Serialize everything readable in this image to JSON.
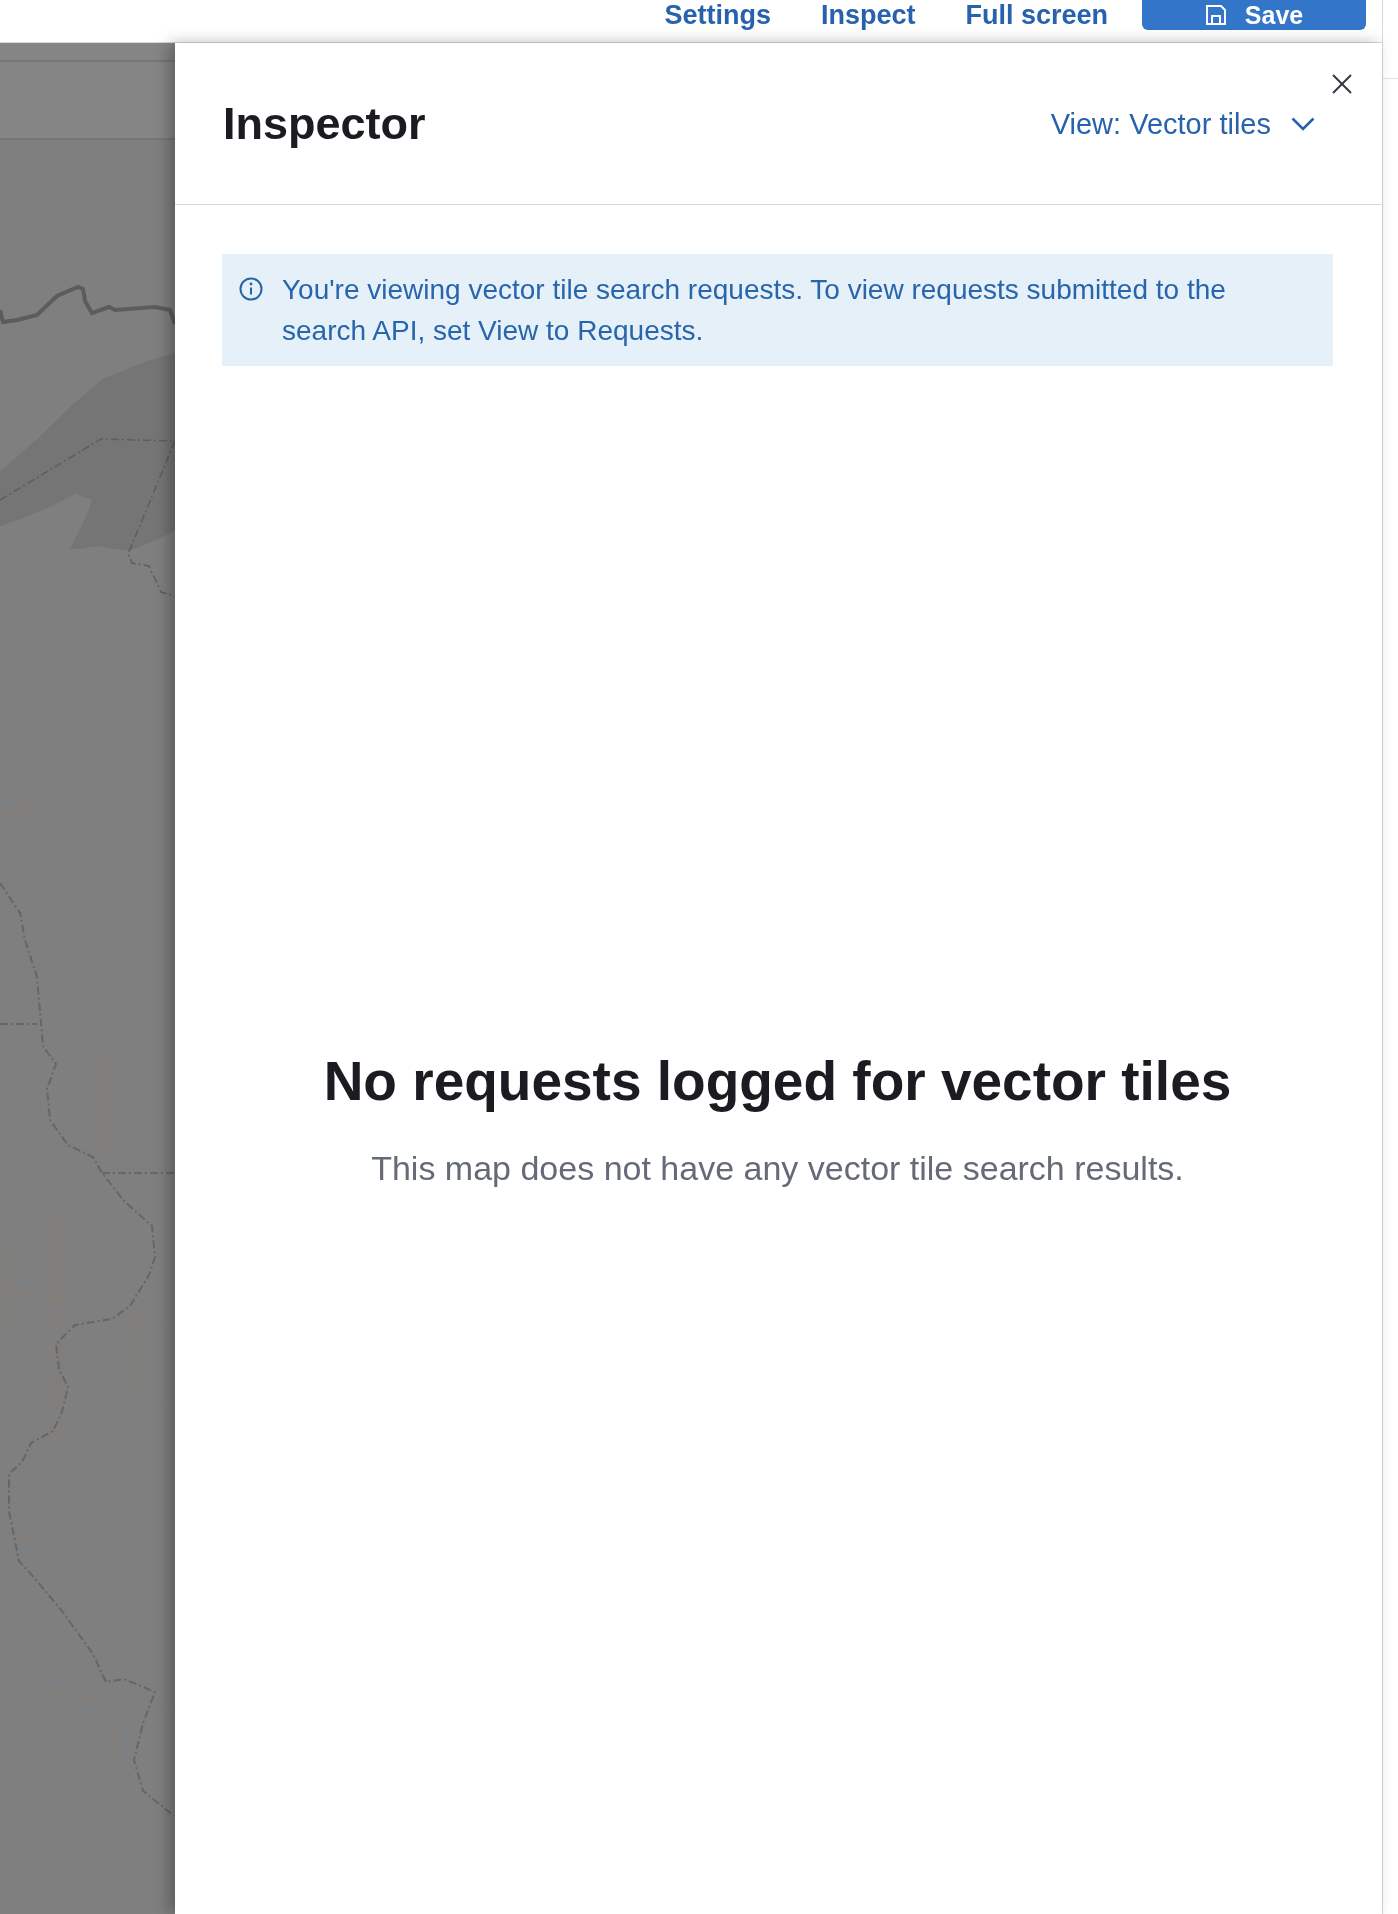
{
  "top_bar": {
    "links": [
      "Settings",
      "Inspect",
      "Full screen"
    ],
    "save_button": {
      "label": "Save"
    }
  },
  "inspector": {
    "title": "Inspector",
    "view_selector": {
      "label": "View: Vector tiles"
    },
    "callout": {
      "text": "You're viewing vector tile search requests. To view requests submitted to the search API, set View to Requests."
    },
    "empty_state": {
      "title": "No requests logged for vector tiles",
      "body": "This map does not have any vector tile search results."
    }
  }
}
